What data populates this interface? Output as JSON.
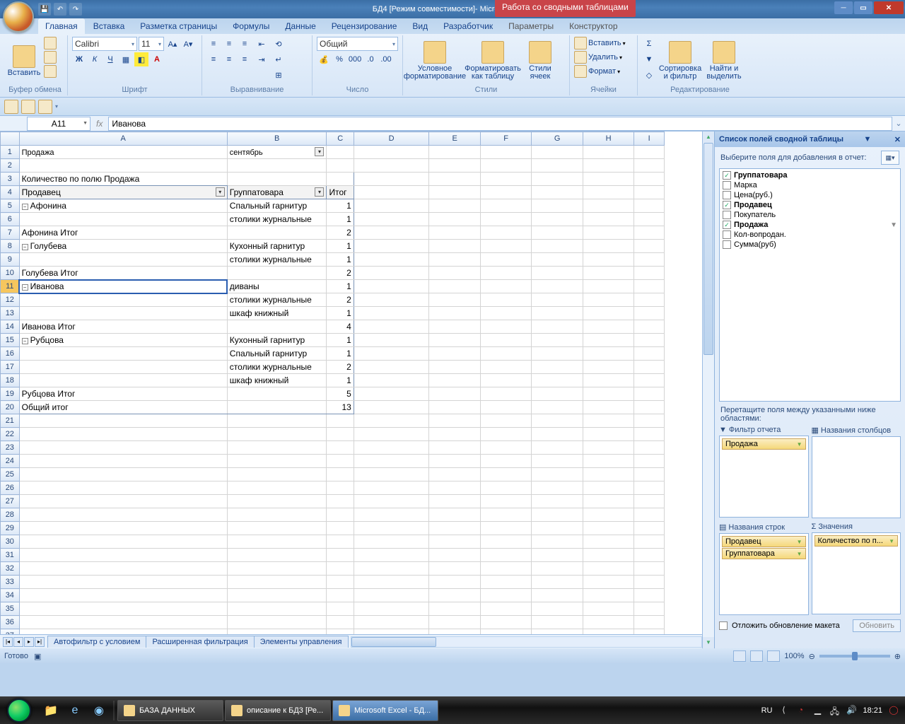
{
  "title": {
    "doc": "БД4  [Режим совместимости]",
    "app": " - Microsoft Excel",
    "pivot_tools": "Работа со сводными таблицами"
  },
  "tabs": [
    "Главная",
    "Вставка",
    "Разметка страницы",
    "Формулы",
    "Данные",
    "Рецензирование",
    "Вид",
    "Разработчик",
    "Параметры",
    "Конструктор"
  ],
  "ribbon": {
    "clipboard": {
      "paste": "Вставить",
      "label": "Буфер обмена"
    },
    "font": {
      "name": "Calibri",
      "size": "11",
      "label": "Шрифт"
    },
    "align": {
      "label": "Выравнивание"
    },
    "number": {
      "format": "Общий",
      "label": "Число"
    },
    "styles": {
      "cond": "Условное\nформатирование",
      "table": "Форматировать\nкак таблицу",
      "cell": "Стили\nячеек",
      "label": "Стили"
    },
    "cells": {
      "insert": "Вставить",
      "delete": "Удалить",
      "format": "Формат",
      "label": "Ячейки"
    },
    "editing": {
      "sort": "Сортировка\nи фильтр",
      "find": "Найти и\nвыделить",
      "label": "Редактирование"
    }
  },
  "formula_bar": {
    "name": "A11",
    "fx": "fx",
    "value": "Иванова"
  },
  "columns": [
    "A",
    "B",
    "C",
    "D",
    "E",
    "F",
    "G",
    "H",
    "I"
  ],
  "pivot": {
    "r1": {
      "a": "Продажа",
      "b": "сентябрь"
    },
    "r3": {
      "a": "Количество по полю Продажа"
    },
    "r4": {
      "a": "Продавец",
      "b": "Группатовара",
      "c": "Итог"
    },
    "rows": [
      {
        "n": "5",
        "a": "Афонина",
        "b": "Спальный гарнитур",
        "c": "1",
        "exp": true
      },
      {
        "n": "6",
        "a": "",
        "b": "столики журнальные",
        "c": "1"
      },
      {
        "n": "7",
        "a": "Афонина Итог",
        "b": "",
        "c": "2",
        "tot": true
      },
      {
        "n": "8",
        "a": "Голубева",
        "b": "Кухонный гарнитур",
        "c": "1",
        "exp": true
      },
      {
        "n": "9",
        "a": "",
        "b": "столики журнальные",
        "c": "1"
      },
      {
        "n": "10",
        "a": "Голубева Итог",
        "b": "",
        "c": "2",
        "tot": true
      },
      {
        "n": "11",
        "a": "Иванова",
        "b": "диваны",
        "c": "1",
        "exp": true,
        "sel": true
      },
      {
        "n": "12",
        "a": "",
        "b": "столики журнальные",
        "c": "2"
      },
      {
        "n": "13",
        "a": "",
        "b": "шкаф книжный",
        "c": "1"
      },
      {
        "n": "14",
        "a": "Иванова Итог",
        "b": "",
        "c": "4",
        "tot": true
      },
      {
        "n": "15",
        "a": "Рубцова",
        "b": "Кухонный гарнитур",
        "c": "1",
        "exp": true
      },
      {
        "n": "16",
        "a": "",
        "b": "Спальный гарнитур",
        "c": "1"
      },
      {
        "n": "17",
        "a": "",
        "b": "столики журнальные",
        "c": "2"
      },
      {
        "n": "18",
        "a": "",
        "b": "шкаф книжный",
        "c": "1"
      },
      {
        "n": "19",
        "a": "Рубцова Итог",
        "b": "",
        "c": "5",
        "tot": true
      },
      {
        "n": "20",
        "a": "Общий итог",
        "b": "",
        "c": "13",
        "gt": true
      }
    ],
    "blank_start": 21,
    "blank_end": 37
  },
  "sheet_tabs": [
    "Автофильтр с условием",
    "Расширенная фильтрация",
    "Элементы управления"
  ],
  "status": {
    "ready": "Готово",
    "zoom": "100%"
  },
  "pane": {
    "title": "Список полей сводной таблицы",
    "prompt": "Выберите поля для добавления в отчет:",
    "fields": [
      {
        "name": "Группатовара",
        "checked": true,
        "bold": true
      },
      {
        "name": "Марка",
        "checked": false
      },
      {
        "name": "Цена(руб.)",
        "checked": false
      },
      {
        "name": "Продавец",
        "checked": true,
        "bold": true
      },
      {
        "name": "Покупатель",
        "checked": false
      },
      {
        "name": "Продажа",
        "checked": true,
        "bold": true,
        "filter": true
      },
      {
        "name": "Кол-вопродан.",
        "checked": false
      },
      {
        "name": "Сумма(руб)",
        "checked": false
      }
    ],
    "drag": "Перетащите поля между указанными ниже областями:",
    "areas": {
      "filter": {
        "label": "Фильтр отчета",
        "items": [
          "Продажа"
        ]
      },
      "cols": {
        "label": "Названия столбцов",
        "items": []
      },
      "rows": {
        "label": "Названия строк",
        "items": [
          "Продавец",
          "Группатовара"
        ]
      },
      "vals": {
        "label": "Значения",
        "items": [
          "Количество по п..."
        ]
      }
    },
    "defer": "Отложить обновление макета",
    "update": "Обновить"
  },
  "taskbar": {
    "lang": "RU",
    "time": "18:21",
    "tasks": [
      {
        "label": "БАЗА ДАННЫХ",
        "active": false
      },
      {
        "label": "описание к БД3 [Ре...",
        "active": false
      },
      {
        "label": "Microsoft Excel - БД...",
        "active": true
      }
    ]
  },
  "sigma": "Σ"
}
